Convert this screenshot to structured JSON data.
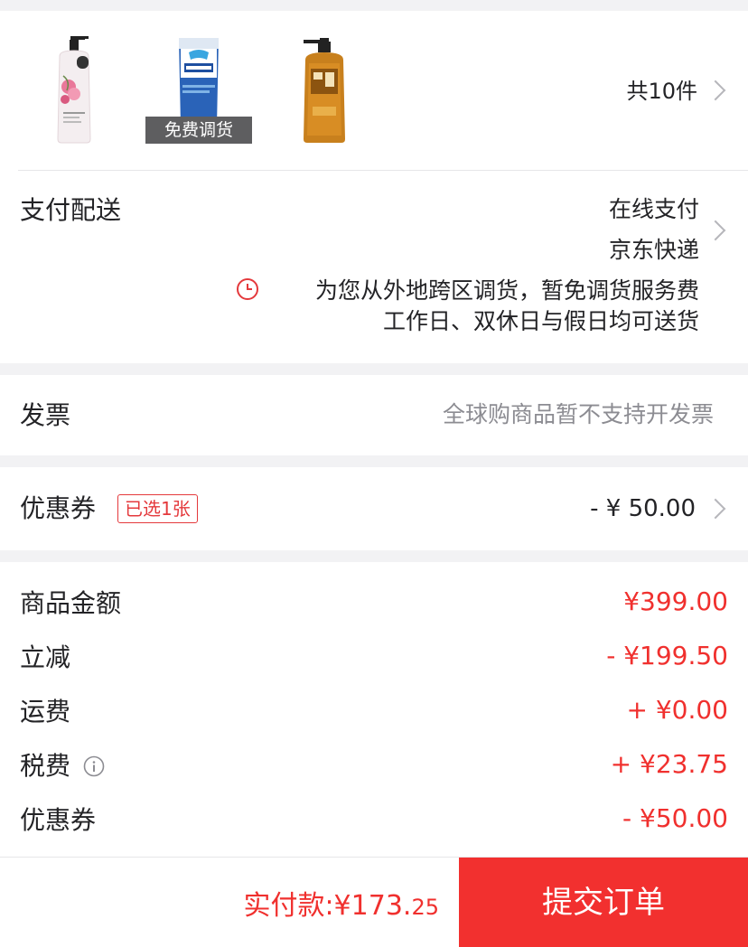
{
  "products": {
    "items": [
      {
        "icon": "lotion-bottle-icon",
        "label": ""
      },
      {
        "icon": "toothpaste-tube-icon",
        "label": "免费调货"
      },
      {
        "icon": "shampoo-bottle-icon",
        "label": ""
      }
    ],
    "count_label": "共10件"
  },
  "payment": {
    "title": "支付配送",
    "method": "在线支付",
    "delivery": "京东快递",
    "notice": "为您从外地跨区调货，暂免调货服务费",
    "schedule": "工作日、双休日与假日均可送货"
  },
  "invoice": {
    "title": "发票",
    "value": "全球购商品暂不支持开发票"
  },
  "coupon": {
    "title": "优惠券",
    "badge": "已选1张",
    "value": "- ¥ 50.00"
  },
  "amounts": [
    {
      "label": "商品金额",
      "value": "¥399.00"
    },
    {
      "label": "立减",
      "value": "- ¥199.50"
    },
    {
      "label": "运费",
      "value": "+ ¥0.00"
    },
    {
      "label": "税费",
      "value": "+ ¥23.75"
    },
    {
      "label": "优惠券",
      "value": "- ¥50.00"
    }
  ],
  "footer": {
    "total_prefix": "实付款:¥173.",
    "total_cents": "25",
    "submit_label": "提交订单"
  },
  "colors": {
    "accent": "#f2302f",
    "price": "#f0302e"
  }
}
